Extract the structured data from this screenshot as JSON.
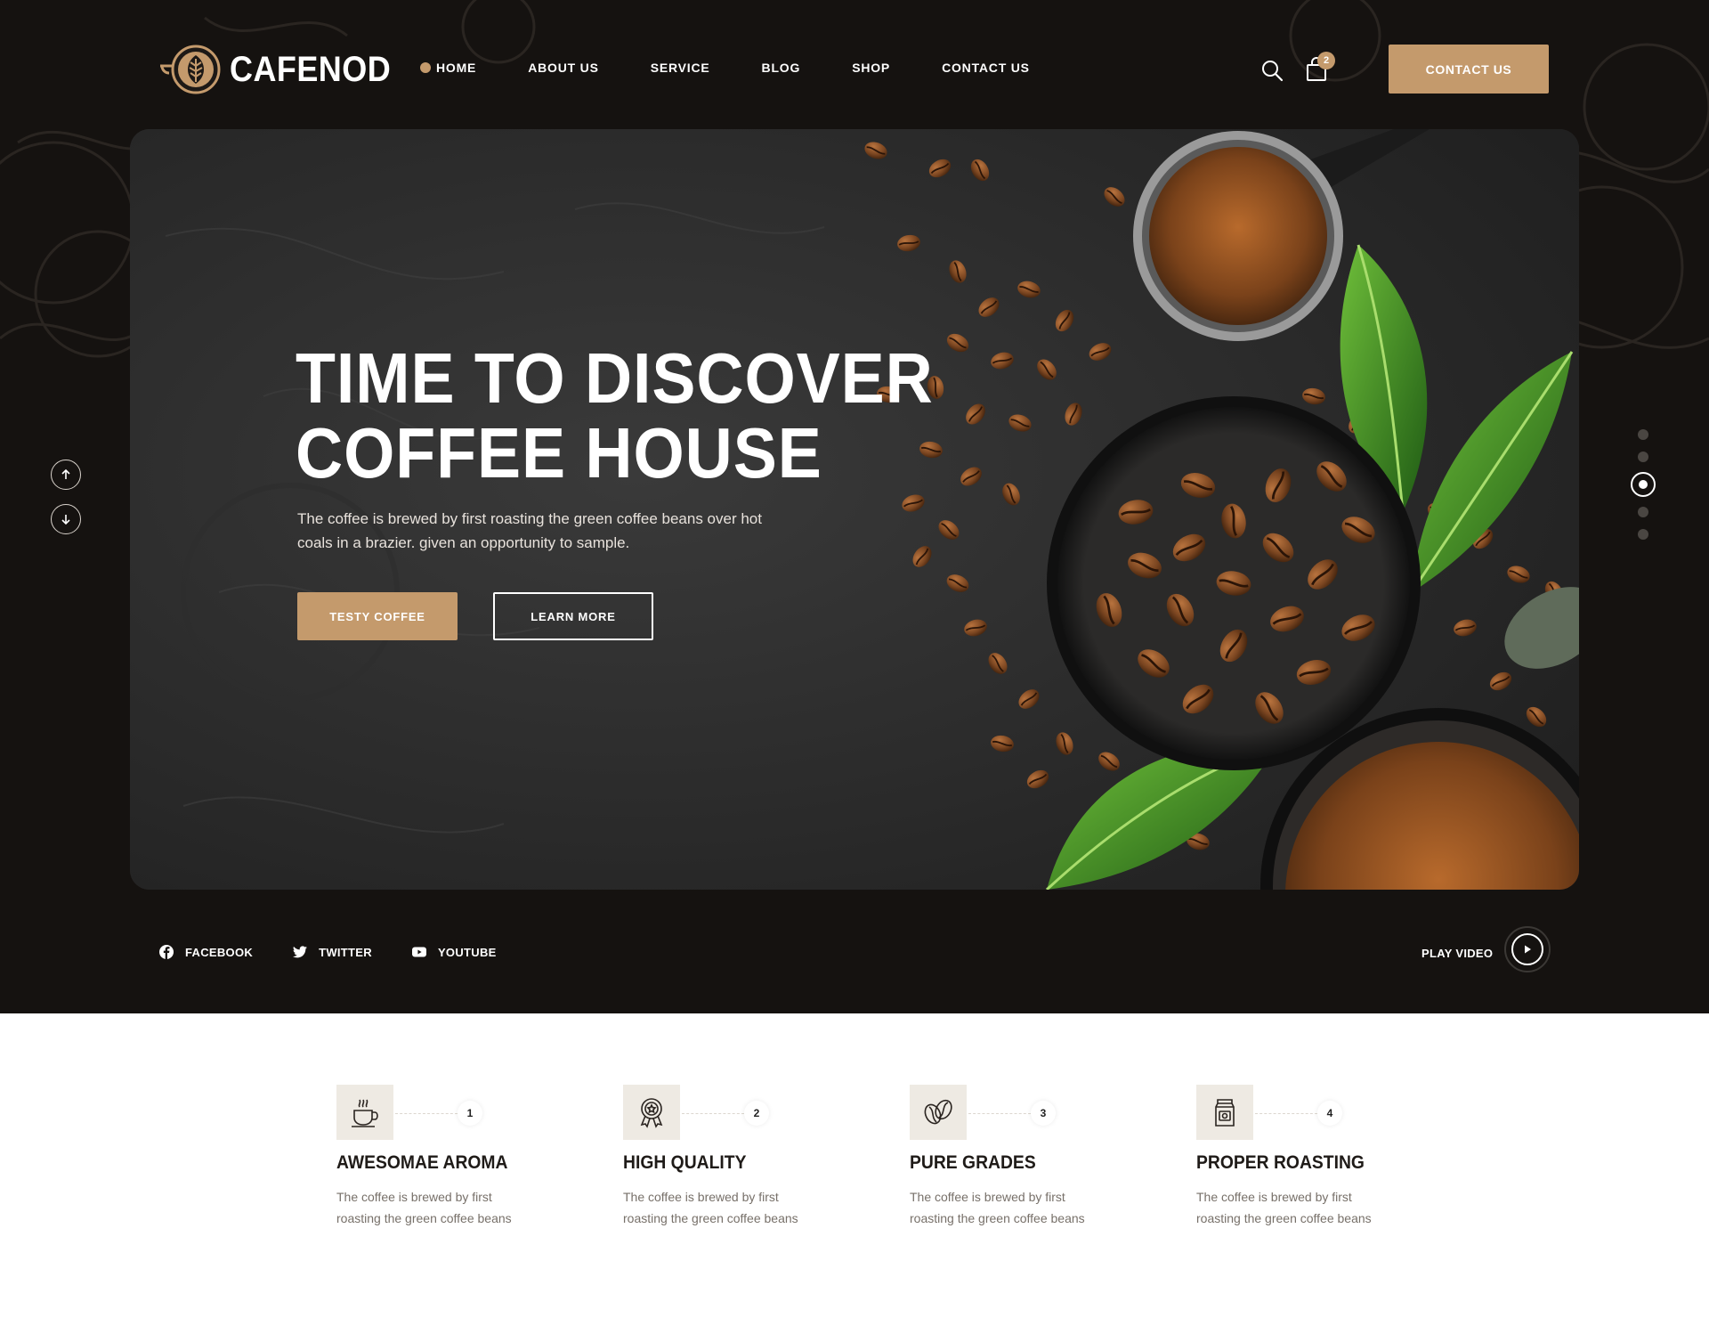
{
  "brand": {
    "name": "CAFENOD",
    "accent": "#c49a6c",
    "dark_bg": "#151210"
  },
  "nav": {
    "items": [
      {
        "label": "HOME",
        "active": true
      },
      {
        "label": "ABOUT US"
      },
      {
        "label": "SERVICE"
      },
      {
        "label": "BLOG"
      },
      {
        "label": "SHOP"
      },
      {
        "label": "CONTACT US"
      }
    ],
    "search_icon": "search-icon",
    "cart_icon": "shopping-bag-icon",
    "cart_count": "2",
    "cta_label": "CONTACT US"
  },
  "hero": {
    "title_line1": "TIME TO DISCOVER",
    "title_line2": "COFFEE HOUSE",
    "description": "The coffee is brewed by first roasting the green coffee beans over hot coals in a brazier. given an opportunity to sample.",
    "primary_button": "TESTY COFFEE",
    "secondary_button": "LEARN MORE",
    "slides": 5,
    "active_slide": 3
  },
  "social": [
    {
      "label": "FACEBOOK",
      "icon": "facebook-icon"
    },
    {
      "label": "TWITTER",
      "icon": "twitter-icon"
    },
    {
      "label": "YOUTUBE",
      "icon": "youtube-icon"
    }
  ],
  "play_video_label": "PLAY VIDEO",
  "features": [
    {
      "number": "1",
      "title": "AWESOMAE AROMA",
      "description": "The coffee is brewed by first roasting the green coffee beans",
      "icon": "coffee-cup-icon"
    },
    {
      "number": "2",
      "title": "HIGH QUALITY",
      "description": "The coffee is brewed by first roasting the green coffee beans",
      "icon": "award-badge-icon"
    },
    {
      "number": "3",
      "title": "PURE GRADES",
      "description": "The coffee is brewed by first roasting the green coffee beans",
      "icon": "coffee-beans-icon"
    },
    {
      "number": "4",
      "title": "PROPER ROASTING",
      "description": "The coffee is brewed by first roasting the green coffee beans",
      "icon": "coffee-bag-icon"
    }
  ]
}
